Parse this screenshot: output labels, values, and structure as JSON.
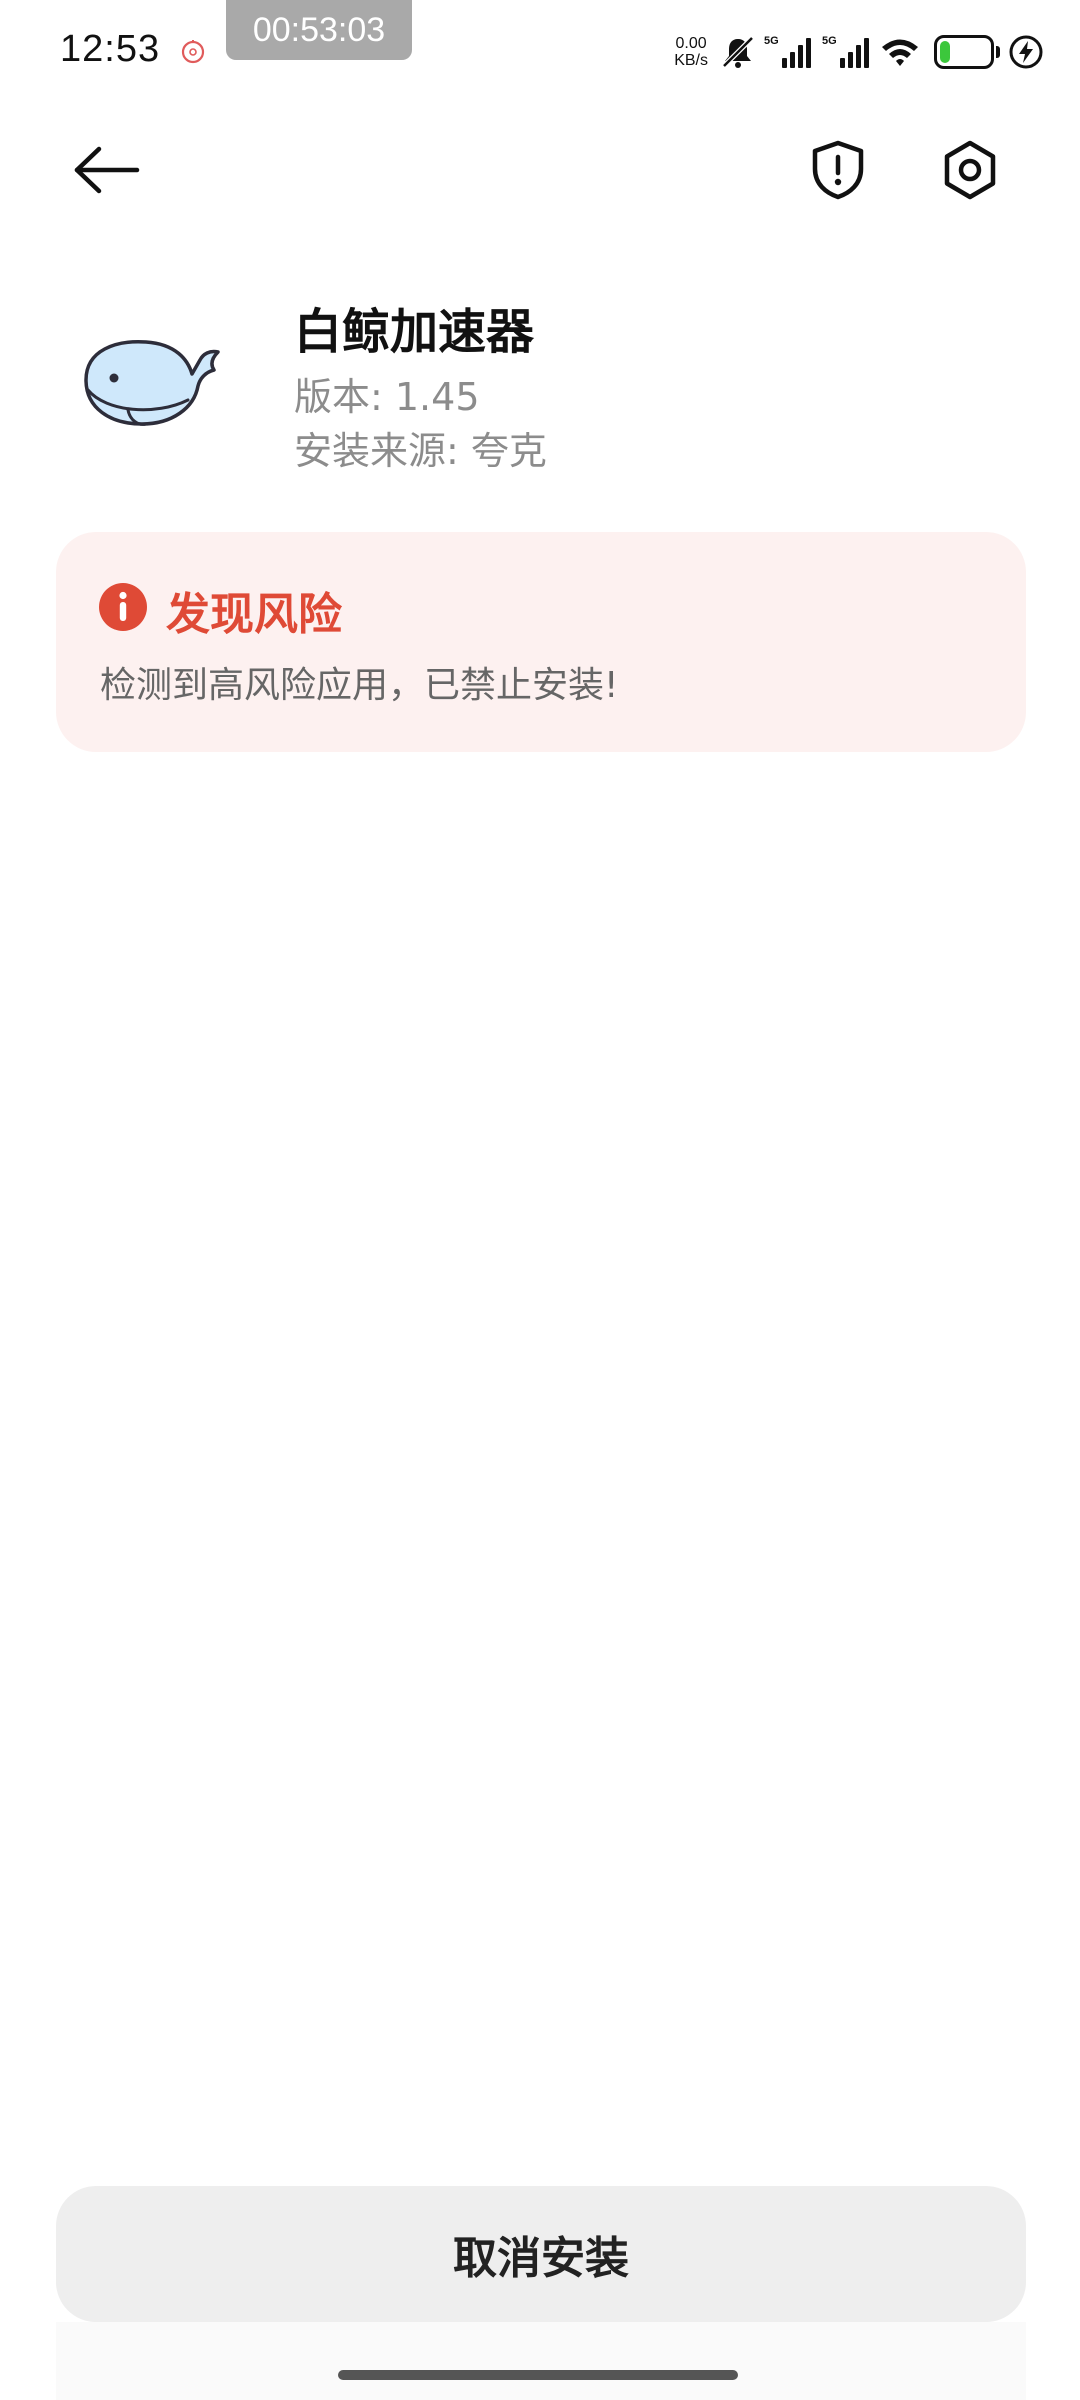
{
  "status_bar": {
    "time": "12:53",
    "timer": "00:53:03",
    "net_speed_value": "0.00",
    "net_speed_unit": "KB/s",
    "sim1_label": "5G",
    "sim2_label": "5G",
    "battery_level": "20",
    "battery_fraction": 0.2,
    "icons": [
      "alarm-icon",
      "mute-icon",
      "signal-icon",
      "wifi-icon",
      "battery-icon",
      "charging-icon"
    ]
  },
  "nav": {
    "icons": [
      "back-arrow-icon",
      "shield-alert-icon",
      "settings-icon"
    ]
  },
  "app": {
    "name": "白鲸加速器",
    "version": "版本: 1.45",
    "source": "安装来源: 夸克",
    "icon": "whale-icon"
  },
  "risk": {
    "title": "发现风险",
    "description": "检测到高风险应用，已禁止安装!",
    "icon": "info-icon",
    "accent_color": "#df4a36",
    "background_color": "#fdf1f0"
  },
  "actions": {
    "cancel_label": "取消安装"
  }
}
